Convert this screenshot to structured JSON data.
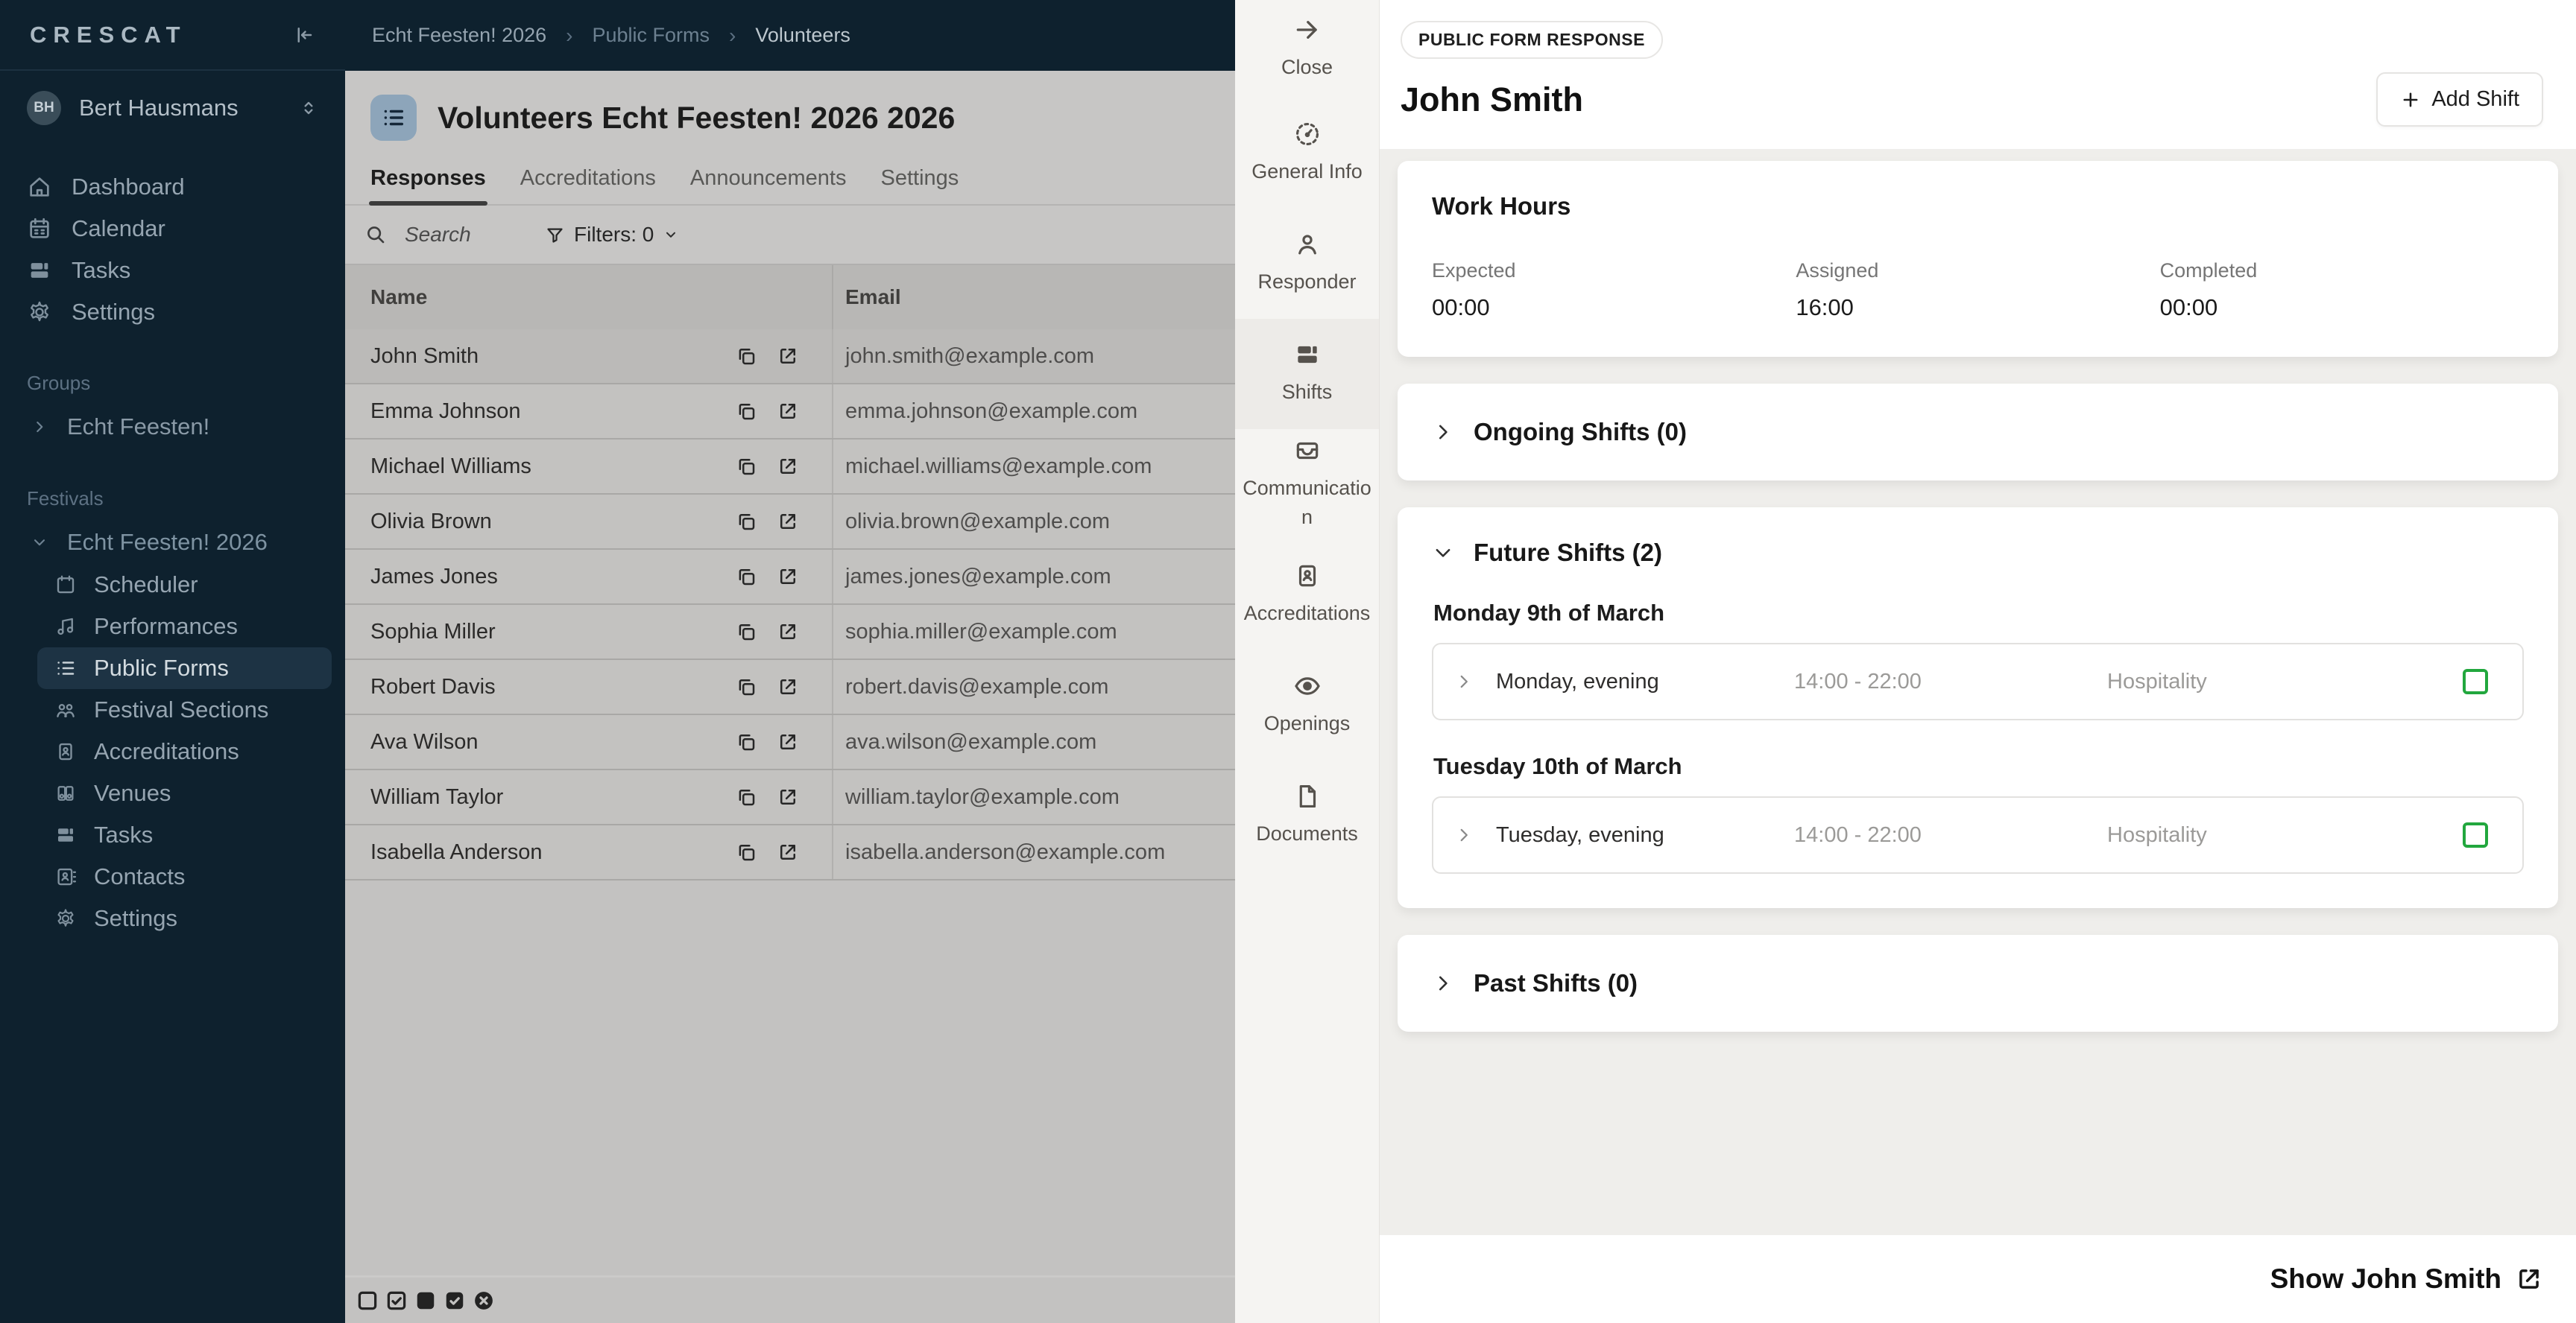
{
  "sidebar": {
    "logo": "CRESCAT",
    "user": {
      "initials": "BH",
      "name": "Bert Hausmans"
    },
    "main_items": [
      {
        "label": "Dashboard"
      },
      {
        "label": "Calendar"
      },
      {
        "label": "Tasks"
      },
      {
        "label": "Settings"
      }
    ],
    "groups_label": "Groups",
    "group_item": "Echt Feesten!",
    "festivals_label": "Festivals",
    "festival_name": "Echt Feesten! 2026",
    "festival_items": [
      {
        "label": "Scheduler"
      },
      {
        "label": "Performances"
      },
      {
        "label": "Public Forms"
      },
      {
        "label": "Festival Sections"
      },
      {
        "label": "Accreditations"
      },
      {
        "label": "Venues"
      },
      {
        "label": "Tasks"
      },
      {
        "label": "Contacts"
      },
      {
        "label": "Settings"
      }
    ]
  },
  "breadcrumb": {
    "items": [
      "Echt Feesten! 2026",
      "Public Forms",
      "Volunteers"
    ],
    "separator": "›"
  },
  "list_panel": {
    "title": "Volunteers Echt Feesten! 2026 2026",
    "tabs": [
      {
        "label": "Responses"
      },
      {
        "label": "Accreditations"
      },
      {
        "label": "Announcements"
      },
      {
        "label": "Settings"
      }
    ],
    "search_placeholder": "Search",
    "filters_label": "Filters: 0",
    "table": {
      "columns": [
        "Name",
        "Email"
      ],
      "rows": [
        {
          "name": "John Smith",
          "email": "john.smith@example.com"
        },
        {
          "name": "Emma Johnson",
          "email": "emma.johnson@example.com"
        },
        {
          "name": "Michael Williams",
          "email": "michael.williams@example.com"
        },
        {
          "name": "Olivia Brown",
          "email": "olivia.brown@example.com"
        },
        {
          "name": "James Jones",
          "email": "james.jones@example.com"
        },
        {
          "name": "Sophia Miller",
          "email": "sophia.miller@example.com"
        },
        {
          "name": "Robert Davis",
          "email": "robert.davis@example.com"
        },
        {
          "name": "Ava Wilson",
          "email": "ava.wilson@example.com"
        },
        {
          "name": "William Taylor",
          "email": "william.taylor@example.com"
        },
        {
          "name": "Isabella Anderson",
          "email": "isabella.anderson@example.com"
        }
      ]
    }
  },
  "drawer_nav": {
    "items": [
      {
        "label": "Close"
      },
      {
        "label": "General Info"
      },
      {
        "label": "Responder"
      },
      {
        "label": "Shifts"
      },
      {
        "label": "Communication"
      },
      {
        "label": "Accreditations"
      },
      {
        "label": "Openings"
      },
      {
        "label": "Documents"
      }
    ]
  },
  "detail": {
    "badge": "PUBLIC FORM RESPONSE",
    "title": "John Smith",
    "add_shift_label": "Add Shift",
    "work_hours": {
      "title": "Work Hours",
      "stats": [
        {
          "label": "Expected",
          "value": "00:00"
        },
        {
          "label": "Assigned",
          "value": "16:00"
        },
        {
          "label": "Completed",
          "value": "00:00"
        }
      ]
    },
    "ongoing": {
      "title": "Ongoing Shifts (0)"
    },
    "future": {
      "title": "Future Shifts (2)",
      "groups": [
        {
          "date": "Monday 9th of March",
          "shifts": [
            {
              "title": "Monday, evening",
              "time": "14:00 - 22:00",
              "department": "Hospitality"
            }
          ]
        },
        {
          "date": "Tuesday 10th of March",
          "shifts": [
            {
              "title": "Tuesday, evening",
              "time": "14:00 - 22:00",
              "department": "Hospitality"
            }
          ]
        }
      ]
    },
    "past": {
      "title": "Past Shifts (0)"
    },
    "footer_link": "Show John Smith"
  },
  "colors": {
    "sidebar_bg": "#0e212e",
    "selected_item_bg": "#1d3344",
    "title_icon_bg": "#8da5ba",
    "drawer_bg": "#f5f4f2",
    "drawer_active_bg": "#edebe8",
    "detail_bg": "#efeeeb",
    "shift_checkbox_green": "#22a73e"
  }
}
